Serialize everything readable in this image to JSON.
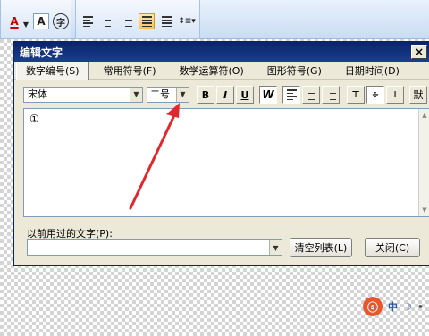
{
  "toolbar": {
    "font_color_label": "A",
    "char_shade_label": "A",
    "enclose_char_label": "字"
  },
  "dialog": {
    "title": "编辑文字",
    "close_label": "×",
    "menus": [
      {
        "label": "数字编号(S)",
        "selected": true
      },
      {
        "label": "常用符号(F)",
        "selected": false
      },
      {
        "label": "数学运算符(O)",
        "selected": false
      },
      {
        "label": "图形符号(G)",
        "selected": false
      },
      {
        "label": "日期时间(D)",
        "selected": false
      }
    ],
    "font_value": "宋体",
    "size_value": "二号",
    "format_buttons": {
      "bold": "B",
      "italic": "I",
      "underline": "U",
      "outline": "W",
      "more": "默"
    },
    "text_content": "①",
    "recent_label": "以前用过的文字(P):",
    "clear_button": "清空列表(L)",
    "close_button": "关闭(C)"
  },
  "ime": {
    "brand_glyph": "ⓢ",
    "mode_label": "中"
  }
}
